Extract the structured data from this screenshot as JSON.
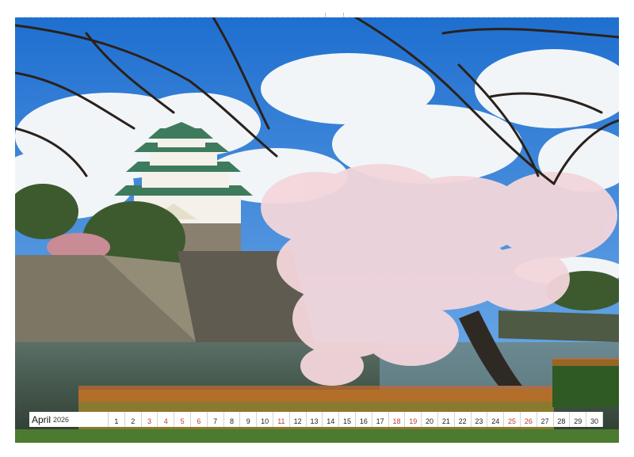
{
  "calendar": {
    "month": "April",
    "year": "2026",
    "days": [
      {
        "num": "1",
        "weekend": false
      },
      {
        "num": "2",
        "weekend": false
      },
      {
        "num": "3",
        "weekend": true
      },
      {
        "num": "4",
        "weekend": true
      },
      {
        "num": "5",
        "weekend": true
      },
      {
        "num": "6",
        "weekend": true
      },
      {
        "num": "7",
        "weekend": false
      },
      {
        "num": "8",
        "weekend": false
      },
      {
        "num": "9",
        "weekend": false
      },
      {
        "num": "10",
        "weekend": false
      },
      {
        "num": "11",
        "weekend": true
      },
      {
        "num": "12",
        "weekend": false
      },
      {
        "num": "13",
        "weekend": false
      },
      {
        "num": "14",
        "weekend": false
      },
      {
        "num": "15",
        "weekend": false
      },
      {
        "num": "16",
        "weekend": false
      },
      {
        "num": "17",
        "weekend": false
      },
      {
        "num": "18",
        "weekend": true
      },
      {
        "num": "19",
        "weekend": true
      },
      {
        "num": "20",
        "weekend": false
      },
      {
        "num": "21",
        "weekend": false
      },
      {
        "num": "22",
        "weekend": false
      },
      {
        "num": "23",
        "weekend": false
      },
      {
        "num": "24",
        "weekend": false
      },
      {
        "num": "25",
        "weekend": true
      },
      {
        "num": "26",
        "weekend": true
      },
      {
        "num": "27",
        "weekend": false
      },
      {
        "num": "28",
        "weekend": false
      },
      {
        "num": "29",
        "weekend": false
      },
      {
        "num": "30",
        "weekend": false
      }
    ]
  },
  "colors": {
    "weekend": "#c0392b",
    "sky": "#2f7fd4",
    "blossom": "#f1d3d8",
    "water": "#3b4a3a"
  }
}
